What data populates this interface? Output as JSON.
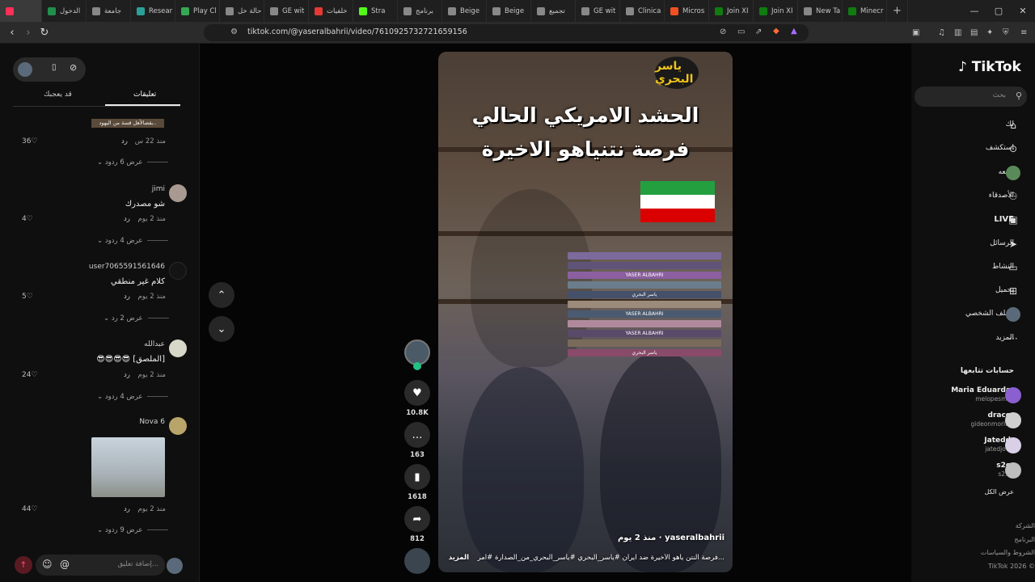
{
  "browser": {
    "tabs": [
      {
        "label": "",
        "color": "#ff2f56"
      },
      {
        "label": "الدخول",
        "color": "#1f8f4e"
      },
      {
        "label": "جامعة",
        "color": "#888888"
      },
      {
        "label": "Resear",
        "color": "#2aa198"
      },
      {
        "label": "Play Cl",
        "color": "#34a853"
      },
      {
        "label": "حالة خل",
        "color": "#888888"
      },
      {
        "label": "GE wit",
        "color": "#888888"
      },
      {
        "label": "خلفيات",
        "color": "#e53935"
      },
      {
        "label": "Stra",
        "color": "#53fc18"
      },
      {
        "label": "برنامج",
        "color": "#888888"
      },
      {
        "label": "Beige",
        "color": "#888888"
      },
      {
        "label": "Beige",
        "color": "#888888"
      },
      {
        "label": "تجميع",
        "color": "#888888"
      },
      {
        "label": "GE wit",
        "color": "#888888"
      },
      {
        "label": "Clinica",
        "color": "#888888"
      },
      {
        "label": "Micros",
        "color": "#f25022"
      },
      {
        "label": "Join XI",
        "color": "#107c10"
      },
      {
        "label": "Join XI",
        "color": "#107c10"
      },
      {
        "label": "New Ta",
        "color": "#888888"
      },
      {
        "label": "Minecr",
        "color": "#107c10"
      }
    ],
    "new_tab": "+",
    "url": "tiktok.com/@yaseralbahrii/video/7610925732721659156"
  },
  "comments_panel": {
    "tab_comments": "تعليقات",
    "tab_creator": "قد يعجبك",
    "comments": [
      {
        "user": "",
        "text": "بقصالأهل قسة من اليهود..",
        "meta": "منذ 22 س",
        "reply": "رد",
        "likes": "36",
        "views": "عرض 6 ردود"
      },
      {
        "user": "jimi",
        "text": "شو مصدرك",
        "meta": "منذ 2 يوم",
        "reply": "رد",
        "likes": "4",
        "views": "عرض 4 ردود"
      },
      {
        "user": "user7065591561646",
        "text": "كلام غير منطقي",
        "meta": "منذ 2 يوم",
        "reply": "رد",
        "likes": "5",
        "views": "عرض 2 رد"
      },
      {
        "user": "عبدالله",
        "text": "😎😎😎😎 [الملصق]",
        "meta": "منذ 2 يوم",
        "reply": "رد",
        "likes": "24",
        "views": "عرض 4 ردود"
      },
      {
        "user": "Nova 6",
        "text": "",
        "meta": "منذ 2 يوم",
        "reply": "رد",
        "likes": "44",
        "views": "عرض 9 ردود"
      }
    ],
    "input_placeholder": "إضافة تعليق..."
  },
  "video": {
    "title_line1": "الحشد الامريكي الحالي",
    "title_line2": "فرصة نتنياهو الاخيرة",
    "brand": "ياسر البحري",
    "author": "yaseralbahrii",
    "posted": "منذ 2 يوم",
    "caption": "فرصة النتن ياهو الأخيرة ضد ايران #ياسر_البحري #ياسر_البحري_من_الصدارة #امر...",
    "more": "المزيد",
    "likes": "10.8K",
    "comments": "163",
    "saves": "1618",
    "shares": "812",
    "book_titles": [
      "YASER ALBAHRI",
      "YASER ALBAHRI",
      "ياسر البحري",
      "YASER ALBAHRI",
      "ياسر البحري"
    ]
  },
  "sidebar": {
    "logo": "TikTok",
    "search_placeholder": "بحث",
    "items": [
      {
        "label": "لك",
        "icon": "home-icon"
      },
      {
        "label": "استكشف",
        "icon": "compass-icon"
      },
      {
        "label": "أتابعه",
        "icon": "following-icon"
      },
      {
        "label": "الأصدقاء",
        "icon": "friends-icon"
      },
      {
        "label": "LIVE",
        "icon": "live-icon"
      },
      {
        "label": "الرسائل",
        "icon": "messages-icon"
      },
      {
        "label": "النشاط",
        "icon": "activity-icon"
      },
      {
        "label": "تحميل",
        "icon": "upload-icon"
      },
      {
        "label": "الملف الشخصي",
        "icon": "profile-icon"
      },
      {
        "label": "المزيد",
        "icon": "more-icon"
      }
    ],
    "following_title": "حسابات تتابعها",
    "following": [
      {
        "name": "Maria Eduarda",
        "handle": "melopesmo",
        "color": "#8a5fcf"
      },
      {
        "name": "draco",
        "handle": "gideonmoritz",
        "color": "#cfcfcf"
      },
      {
        "name": "Jatedd",
        "handle": "jatedjow",
        "color": "#d9d0e8"
      },
      {
        "name": "s2e",
        "handle": "s2.e",
        "color": "#bdbdbd"
      }
    ],
    "see_all": "عرض الكل",
    "footer": [
      "الشركة",
      "البرنامج",
      "الشروط والسياسات",
      "TikTok 2026 ©"
    ]
  }
}
